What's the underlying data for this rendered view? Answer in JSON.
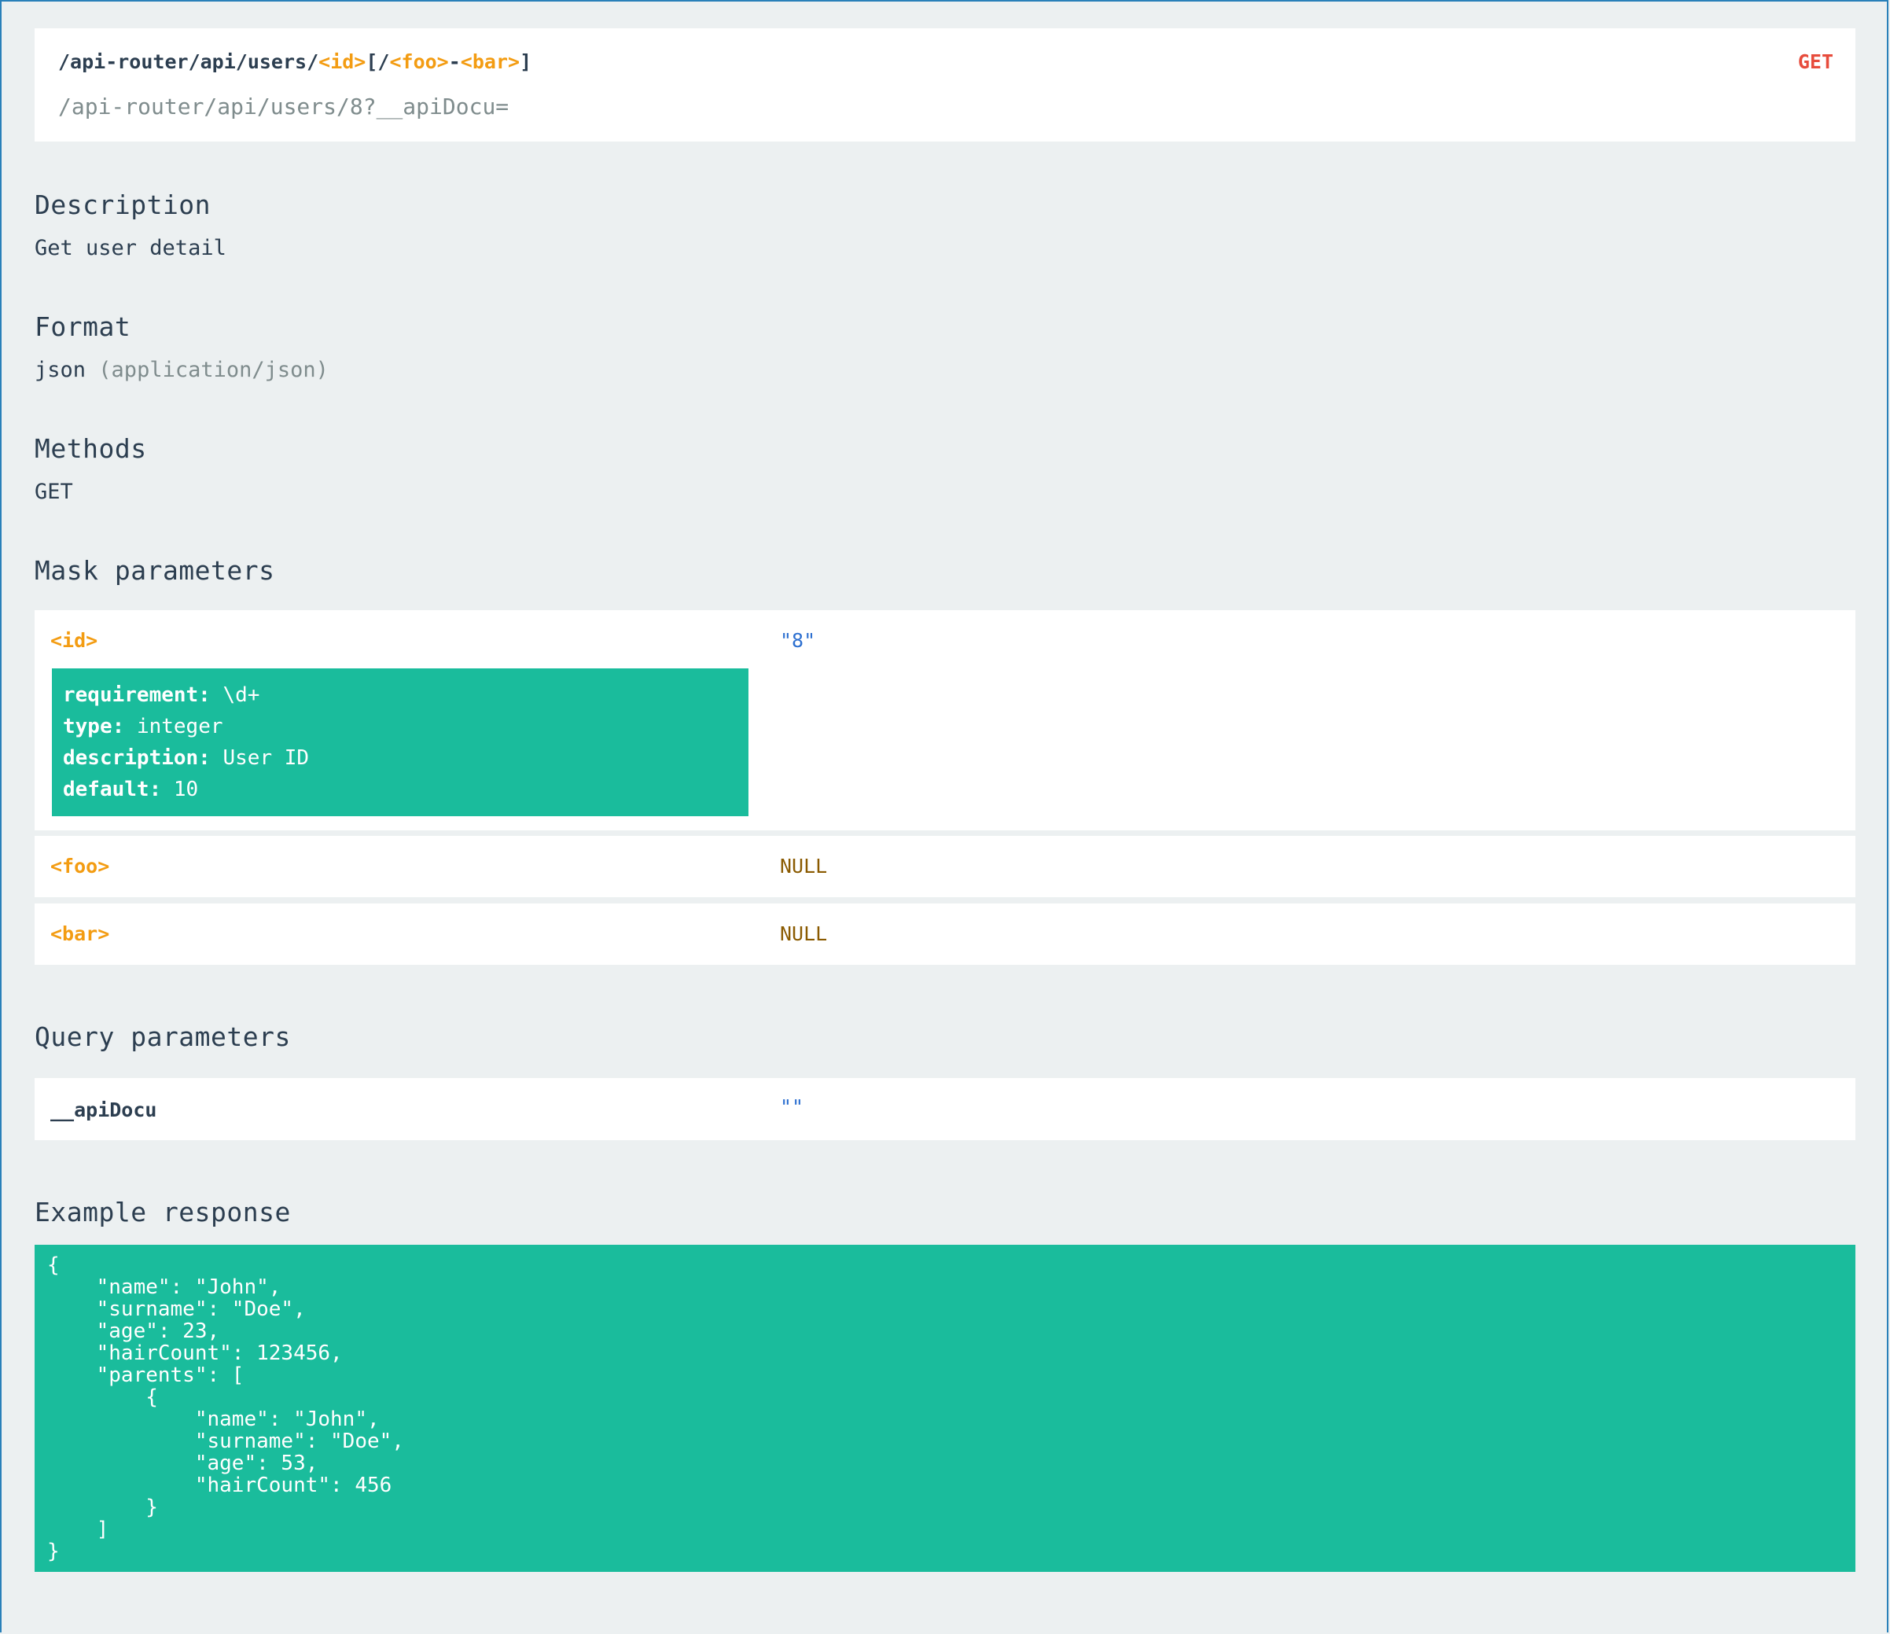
{
  "route": {
    "prefix": "/api-router/api/users/",
    "ph_id": "<id>",
    "open_bracket": "[/",
    "ph_foo": "<foo>",
    "dash": "-",
    "ph_bar": "<bar>",
    "close_bracket": "]",
    "method": "GET",
    "url": "/api-router/api/users/8?__apiDocu="
  },
  "description": {
    "title": "Description",
    "text": "Get user detail"
  },
  "format": {
    "title": "Format",
    "value": "json",
    "mime": "(application/json)"
  },
  "methods": {
    "title": "Methods",
    "value": "GET"
  },
  "mask_parameters": {
    "title": "Mask parameters",
    "items": [
      {
        "name": "<id>",
        "value": "\"8\"",
        "details": [
          {
            "key": "requirement:",
            "value": "\\d+"
          },
          {
            "key": "type:",
            "value": "integer"
          },
          {
            "key": "description:",
            "value": "User ID"
          },
          {
            "key": "default:",
            "value": "10"
          }
        ]
      },
      {
        "name": "<foo>",
        "value": "NULL"
      },
      {
        "name": "<bar>",
        "value": "NULL"
      }
    ]
  },
  "query_parameters": {
    "title": "Query parameters",
    "items": [
      {
        "name": "__apiDocu",
        "value": "\"\""
      }
    ]
  },
  "example_response": {
    "title": "Example response",
    "body": "{\n    \"name\": \"John\",\n    \"surname\": \"Doe\",\n    \"age\": 23,\n    \"hairCount\": 123456,\n    \"parents\": [\n        {\n            \"name\": \"John\",\n            \"surname\": \"Doe\",\n            \"age\": 53,\n            \"hairCount\": 456\n        }\n    ]\n}"
  },
  "colors": {
    "background": "#ecf0f1",
    "card": "#ffffff",
    "accent": "#1abc9c",
    "placeholder": "#f39c12",
    "method": "#e74c3c",
    "frame": "#2980b9"
  }
}
